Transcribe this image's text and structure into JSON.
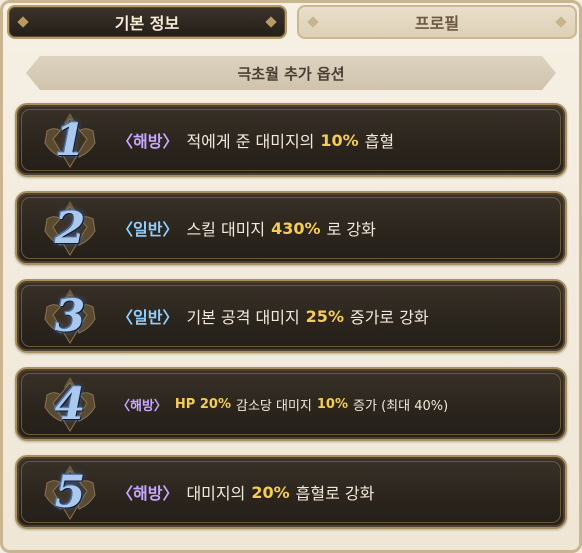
{
  "tabs": {
    "basic_info": "기본 정보",
    "profile": "프로필"
  },
  "section": {
    "title": "극초월 추가 옵션"
  },
  "options": [
    {
      "number": "1",
      "tag": "〈해방〉",
      "tag_type": "haebang",
      "text_before": "적에게 준 대미지의",
      "value": "10%",
      "text_after": "흡혈",
      "trailing": ""
    },
    {
      "number": "2",
      "tag": "〈일반〉",
      "tag_type": "ilban",
      "text_before": "스킬 대미지",
      "value": "430%",
      "text_after": "로 강화",
      "trailing": ""
    },
    {
      "number": "3",
      "tag": "〈일반〉",
      "tag_type": "ilban",
      "text_before": "기본 공격 대미지",
      "value": "25%",
      "text_after": "증가로 강화",
      "trailing": ""
    },
    {
      "number": "4",
      "tag": "〈해방〉",
      "tag_type": "haebang",
      "text_before": "",
      "value_pre": "HP 20%",
      "mid": "감소당 대미지",
      "value": "10%",
      "text_after": "증가 (최대 40%)",
      "trailing": ""
    },
    {
      "number": "5",
      "tag": "〈해방〉",
      "tag_type": "haebang",
      "text_before": "대미지의",
      "value": "20%",
      "text_after": "흡혈로 강화",
      "trailing": ""
    }
  ],
  "colors": {
    "accent_value": "#f5cd53",
    "tag_haebang": "#c7a6ff",
    "tag_ilban": "#8fd0ff",
    "row_bg": "#2a241d",
    "gold_border": "#a8915f"
  },
  "icons": {
    "emblem": "winged-shield-emblem-icon"
  }
}
